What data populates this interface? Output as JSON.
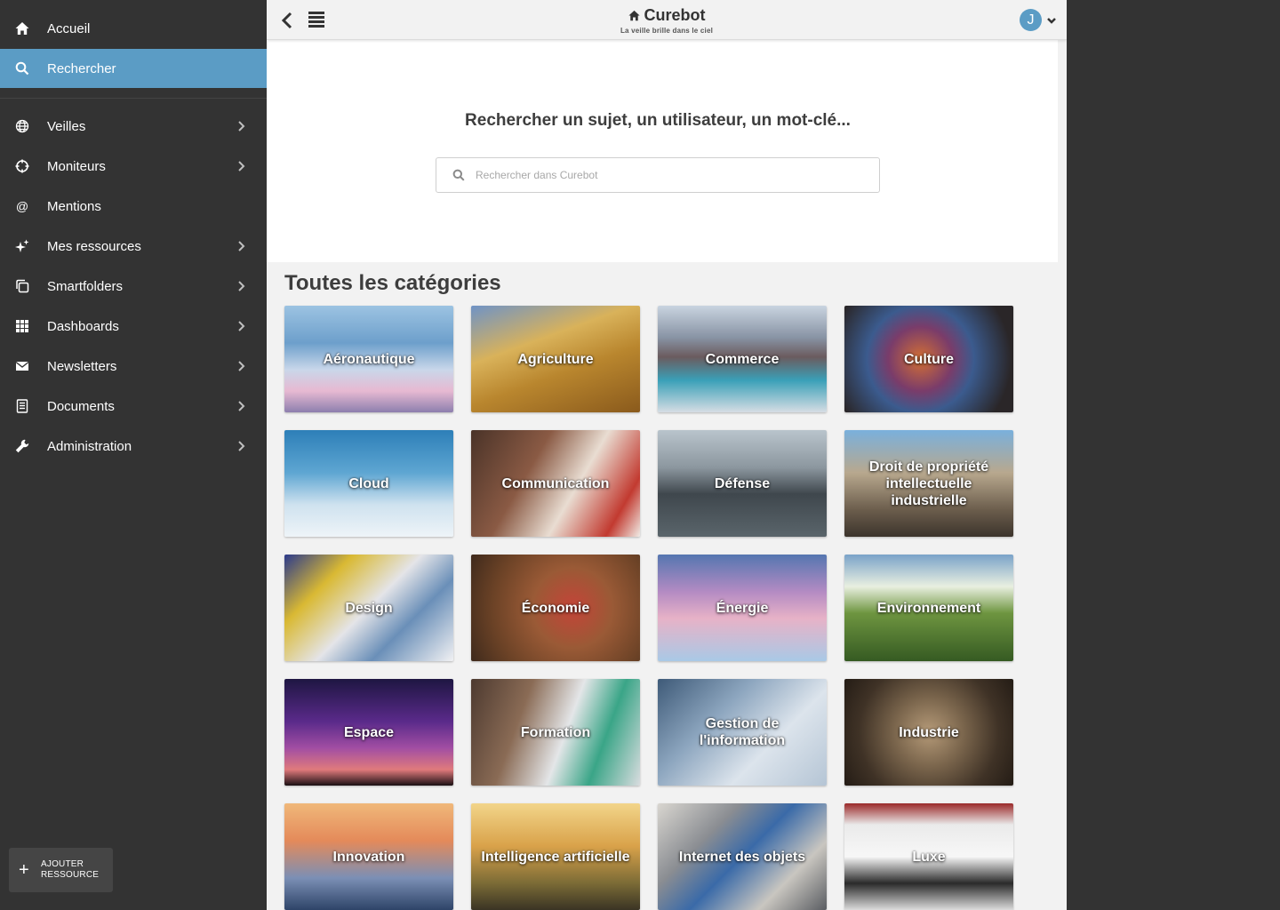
{
  "sidebar": {
    "items": [
      {
        "label": "Accueil",
        "icon": "home-icon",
        "chevron": false,
        "active": false
      },
      {
        "label": "Rechercher",
        "icon": "search-icon",
        "chevron": false,
        "active": true
      },
      {
        "label": "Veilles",
        "icon": "globe-icon",
        "chevron": true,
        "active": false
      },
      {
        "label": "Moniteurs",
        "icon": "crosshair-icon",
        "chevron": true,
        "active": false
      },
      {
        "label": "Mentions",
        "icon": "at-icon",
        "chevron": false,
        "active": false
      },
      {
        "label": "Mes ressources",
        "icon": "sparkle-icon",
        "chevron": true,
        "active": false
      },
      {
        "label": "Smartfolders",
        "icon": "folders-icon",
        "chevron": true,
        "active": false
      },
      {
        "label": "Dashboards",
        "icon": "grid-icon",
        "chevron": true,
        "active": false
      },
      {
        "label": "Newsletters",
        "icon": "envelope-icon",
        "chevron": true,
        "active": false
      },
      {
        "label": "Documents",
        "icon": "document-icon",
        "chevron": true,
        "active": false
      },
      {
        "label": "Administration",
        "icon": "wrench-icon",
        "chevron": true,
        "active": false
      }
    ],
    "add_resource": {
      "label": "AJOUTER\nRESSOURCE"
    }
  },
  "header": {
    "title": "Curebot",
    "subtitle": "La veille brille dans le ciel",
    "avatar_initial": "J"
  },
  "search": {
    "heading": "Rechercher un sujet, un utilisateur, un mot-clé...",
    "placeholder": "Rechercher dans Curebot"
  },
  "categories": {
    "heading": "Toutes les catégories",
    "items": [
      {
        "label": "Aéronautique"
      },
      {
        "label": "Agriculture"
      },
      {
        "label": "Commerce"
      },
      {
        "label": "Culture"
      },
      {
        "label": "Cloud"
      },
      {
        "label": "Communication"
      },
      {
        "label": "Défense"
      },
      {
        "label": "Droit de propriété intellectuelle industrielle"
      },
      {
        "label": "Design"
      },
      {
        "label": "Économie"
      },
      {
        "label": "Énergie"
      },
      {
        "label": "Environnement"
      },
      {
        "label": "Espace"
      },
      {
        "label": "Formation"
      },
      {
        "label": "Gestion de l'information"
      },
      {
        "label": "Industrie"
      },
      {
        "label": "Innovation"
      },
      {
        "label": "Intelligence artificielle"
      },
      {
        "label": "Internet des objets"
      },
      {
        "label": "Luxe"
      }
    ]
  },
  "colors": {
    "accent": "#5b9cc5",
    "sidebar_bg": "#333333",
    "main_bg": "#f2f2f2"
  }
}
